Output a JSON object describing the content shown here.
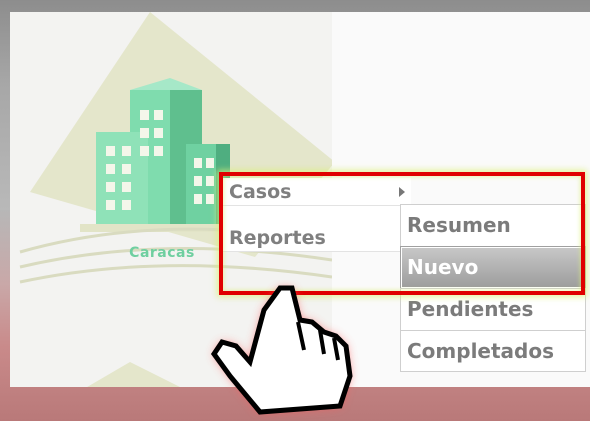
{
  "logo": {
    "text": "Caracas",
    "icon": "building-icon"
  },
  "menu": {
    "items": [
      {
        "label": "Casos",
        "has_submenu": true
      },
      {
        "label": "Reportes",
        "has_submenu": false
      }
    ]
  },
  "submenu": {
    "items": [
      {
        "label": "Resumen",
        "active": false
      },
      {
        "label": "Nuevo",
        "active": true
      },
      {
        "label": "Pendientes",
        "active": false
      },
      {
        "label": "Completados",
        "active": false
      }
    ]
  },
  "colors": {
    "highlight_border": "#e00000",
    "logo_green": "#6fcfa0",
    "active_item": "#a8a8a8"
  },
  "cursor": {
    "icon": "hand-pointer-icon"
  }
}
